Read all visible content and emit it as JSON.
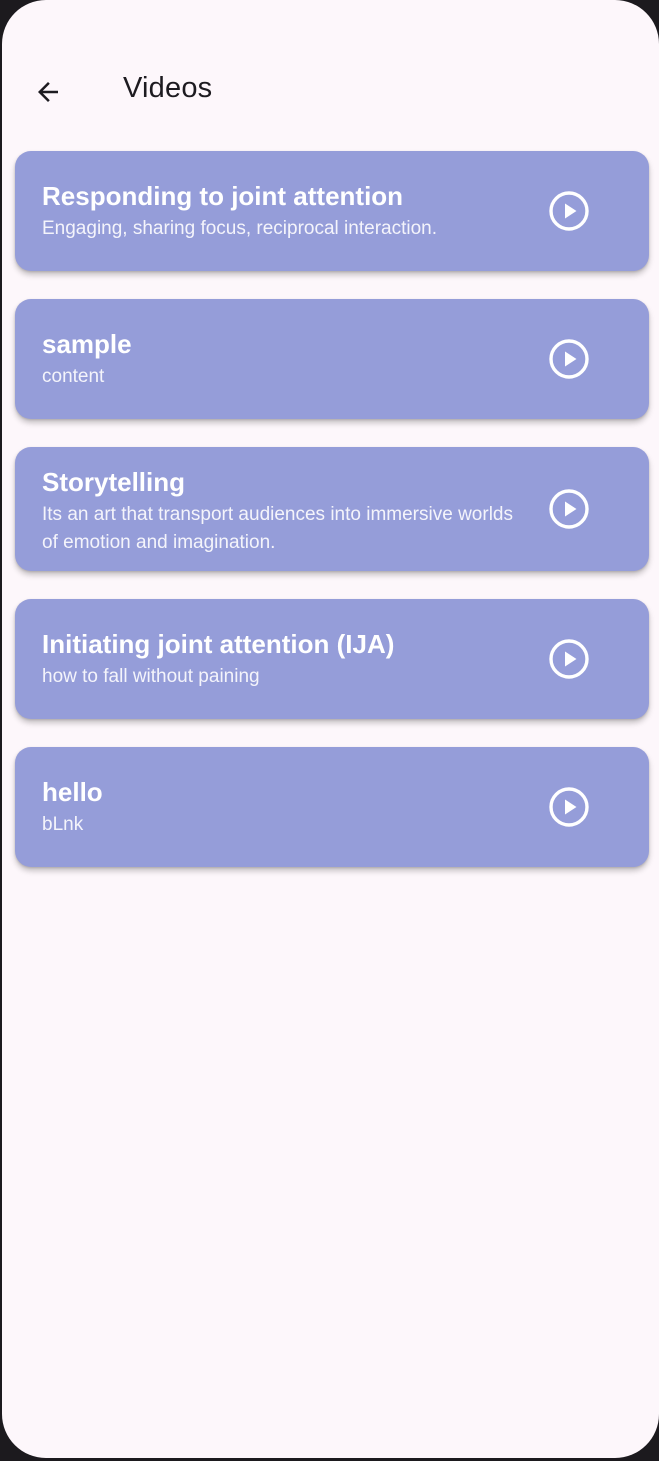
{
  "header": {
    "title": "Videos",
    "back_icon": "arrow-left-icon"
  },
  "videos": [
    {
      "title": "Responding to joint attention",
      "description": "Engaging, sharing focus, reciprocal interaction.",
      "icon": "play-circle-icon"
    },
    {
      "title": "sample",
      "description": "content",
      "icon": "play-circle-icon"
    },
    {
      "title": "Storytelling",
      "description": "Its an art that transport audiences into immersive worlds of emotion and imagination.",
      "icon": "play-circle-icon"
    },
    {
      "title": "Initiating joint attention (IJA)",
      "description": "how to fall without paining",
      "icon": "play-circle-icon"
    },
    {
      "title": "hello",
      "description": "bLnk",
      "icon": "play-circle-icon"
    }
  ],
  "colors": {
    "card_background": "#959dd9",
    "screen_background": "#fdf7fb",
    "text_on_card": "#ffffff"
  }
}
